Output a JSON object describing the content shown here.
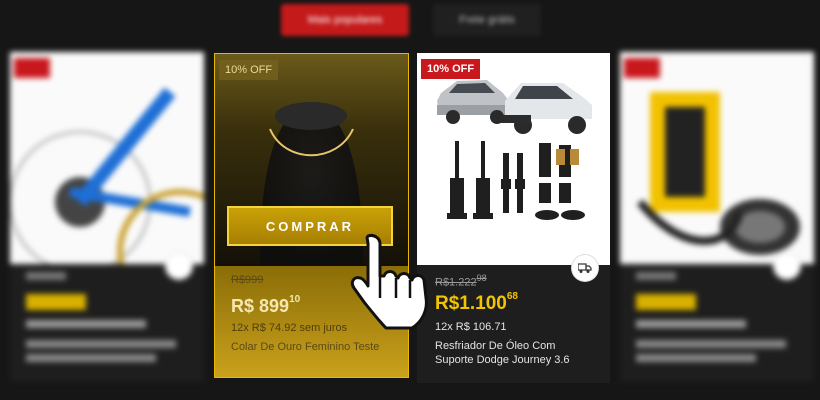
{
  "tabs": [
    {
      "label": "Mais populares"
    },
    {
      "label": "Frete grátis"
    }
  ],
  "cards": [
    {
      "badge": "10% OFF",
      "old_price": "R$1.222",
      "old_price_cents": "98",
      "price_prefix": "R$",
      "price_int": "1.100",
      "price_cents": "68",
      "installments": "12x R$ 106.71",
      "title_line1": "Resfriador De Óleo Com",
      "title_line2": "Suporte Dodge Journey 3.6"
    },
    {
      "badge": "10% OFF",
      "button": "COMPRAR",
      "old_price": "R$999",
      "price_prefix": "R$",
      "price_int": "899",
      "price_cents": "10",
      "installments": "12x R$ 74.92 sem juros",
      "title": "Colar De Ouro Feminino Teste"
    }
  ],
  "colors": {
    "accent_red": "#c8171d",
    "price_yellow": "#f3c400",
    "gold": "#e6b800",
    "background": "#161616"
  },
  "icons": {
    "truck": "truck-icon",
    "cursor": "hand-pointer-icon"
  }
}
